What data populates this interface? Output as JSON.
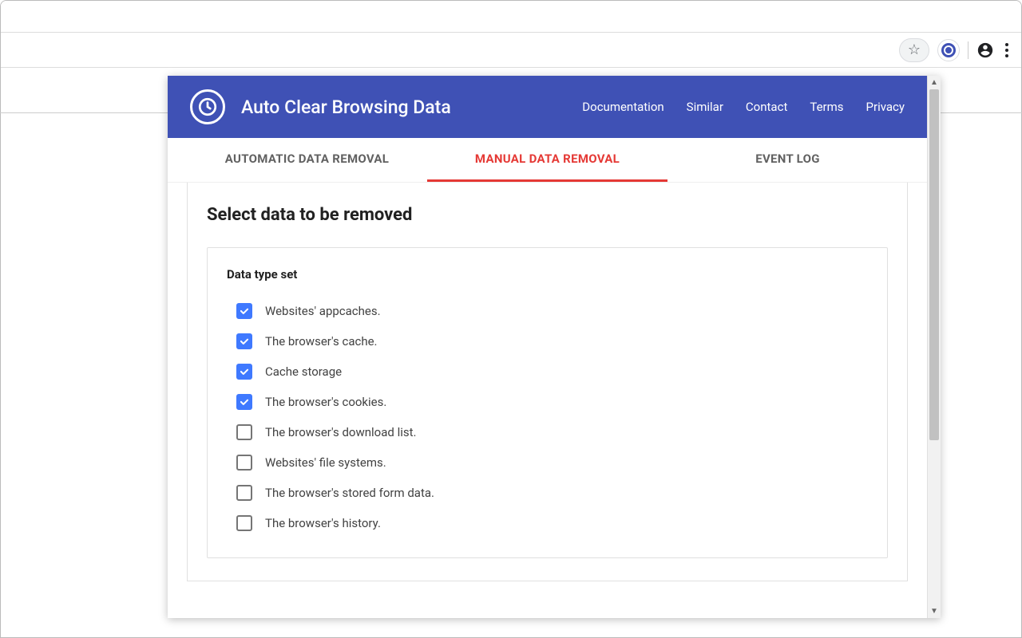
{
  "app": {
    "title": "Auto Clear Browsing Data"
  },
  "nav": {
    "documentation": "Documentation",
    "similar": "Similar",
    "contact": "Contact",
    "terms": "Terms",
    "privacy": "Privacy"
  },
  "tabs": {
    "automatic": "AUTOMATIC DATA REMOVAL",
    "manual": "MANUAL DATA REMOVAL",
    "log": "EVENT LOG",
    "active": "manual"
  },
  "panel": {
    "title": "Select data to be removed",
    "section_title": "Data type set",
    "items": [
      {
        "label": "Websites' appcaches.",
        "checked": true
      },
      {
        "label": "The browser's cache.",
        "checked": true
      },
      {
        "label": "Cache storage",
        "checked": true
      },
      {
        "label": "The browser's cookies.",
        "checked": true
      },
      {
        "label": "The browser's download list.",
        "checked": false
      },
      {
        "label": "Websites' file systems.",
        "checked": false
      },
      {
        "label": "The browser's stored form data.",
        "checked": false
      },
      {
        "label": "The browser's history.",
        "checked": false
      }
    ]
  }
}
